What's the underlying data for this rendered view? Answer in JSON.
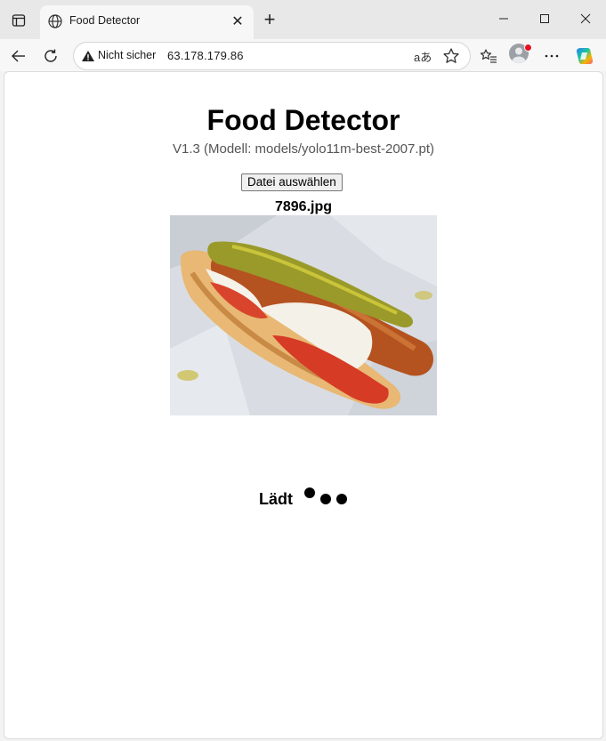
{
  "browser": {
    "tab_title": "Food Detector",
    "security_label": "Nicht sicher",
    "url": "63.178.179.86",
    "translate_glyph": "aあ"
  },
  "page": {
    "title": "Food Detector",
    "version": "V1.3 (Modell: models/yolo11m-best-2007.pt)",
    "file_button": "Datei auswählen",
    "filename": "7896.jpg",
    "loading_text": "Lädt"
  },
  "colors": {
    "copilot_gradient": [
      "#2b7cf6",
      "#f3607a",
      "#f7b500",
      "#18c5a2"
    ]
  }
}
